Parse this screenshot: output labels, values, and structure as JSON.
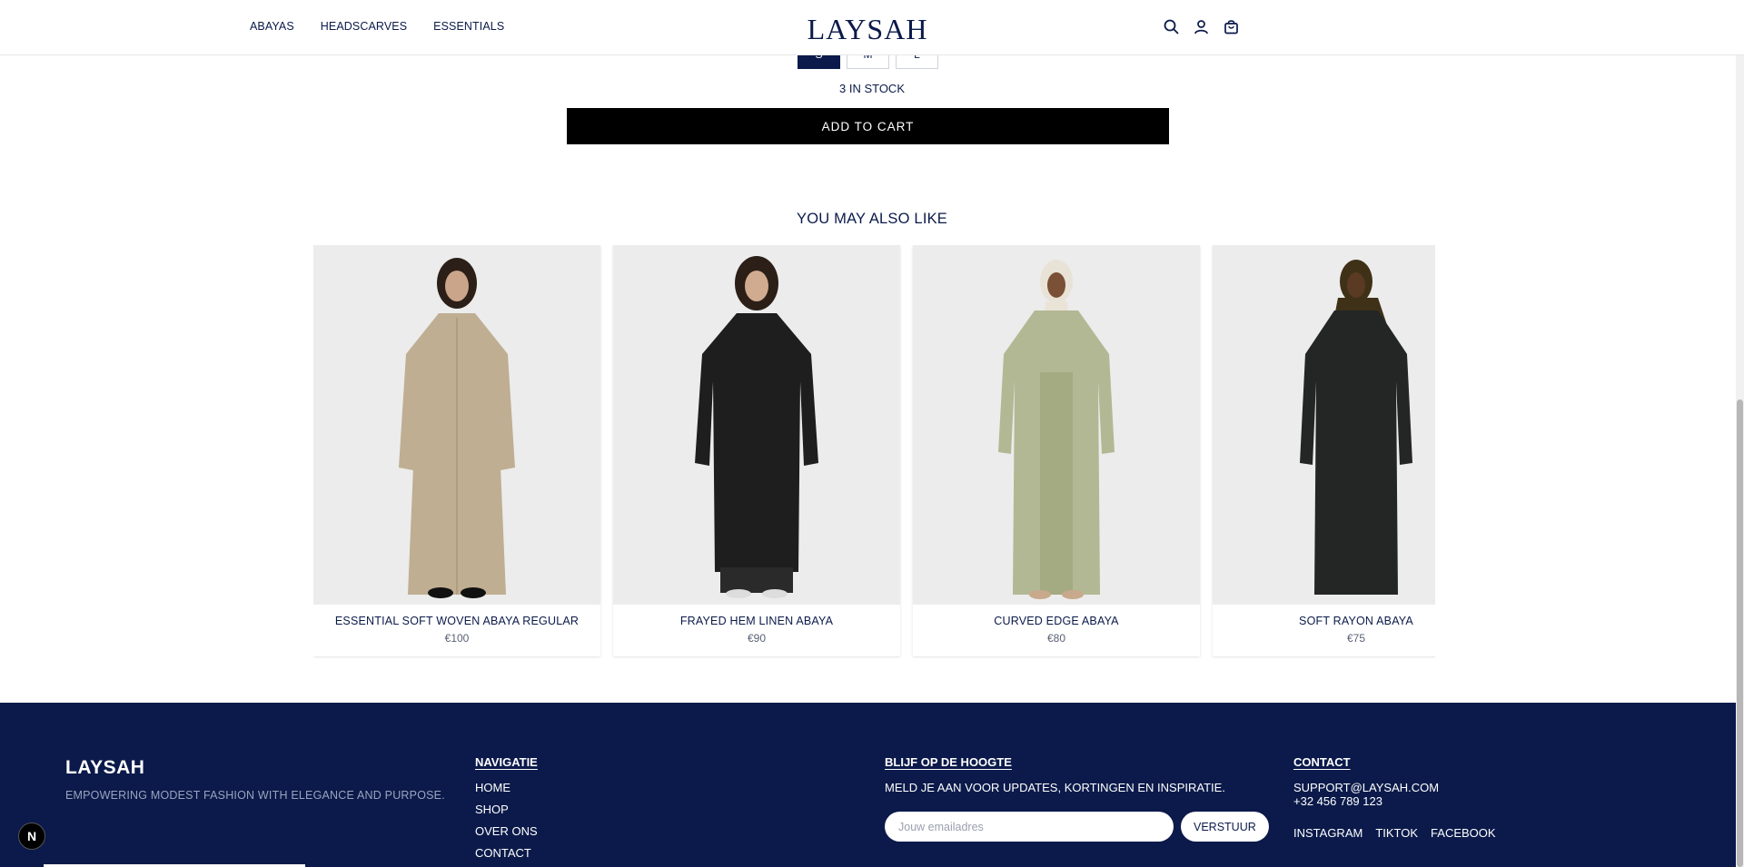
{
  "header": {
    "nav": [
      "ABAYAS",
      "HEADSCARVES",
      "ESSENTIALS"
    ],
    "logo": "LAYSAH"
  },
  "product": {
    "sizes": [
      "S",
      "M",
      "L"
    ],
    "selected_size": "S",
    "stock": "3 IN STOCK",
    "add_to_cart": "ADD TO CART"
  },
  "related": {
    "title": "YOU MAY ALSO LIKE",
    "items": [
      {
        "name": "ESSENTIAL SOFT WOVEN ABAYA REGULAR",
        "price": "€100",
        "color": "#bfae92"
      },
      {
        "name": "FRAYED HEM LINEN ABAYA",
        "price": "€90",
        "color": "#1e1e1e"
      },
      {
        "name": "CURVED EDGE ABAYA",
        "price": "€80",
        "color": "#b3b894"
      },
      {
        "name": "SOFT RAYON ABAYA",
        "price": "€75",
        "color": "#232625"
      }
    ]
  },
  "footer": {
    "brand": "LAYSAH",
    "tagline": "EMPOWERING MODEST FASHION WITH ELEGANCE AND PURPOSE.",
    "nav_title": "NAVIGATIE",
    "nav_links": [
      "HOME",
      "SHOP",
      "OVER ONS",
      "CONTACT"
    ],
    "newsletter_title": "BLIJF OP DE HOOGTE",
    "newsletter_text": "MELD JE AAN VOOR UPDATES, KORTINGEN EN INSPIRATIE.",
    "newsletter_placeholder": "Jouw emailadres",
    "newsletter_button": "VERSTUUR",
    "contact_title": "CONTACT",
    "email": "SUPPORT@LAYSAH.COM",
    "phone": "+32 456 789 123",
    "socials": [
      "INSTAGRAM",
      "TIKTOK",
      "FACEBOOK"
    ]
  },
  "badge": "N",
  "colors": {
    "navy": "#0b1a4a",
    "button": "#000000"
  }
}
